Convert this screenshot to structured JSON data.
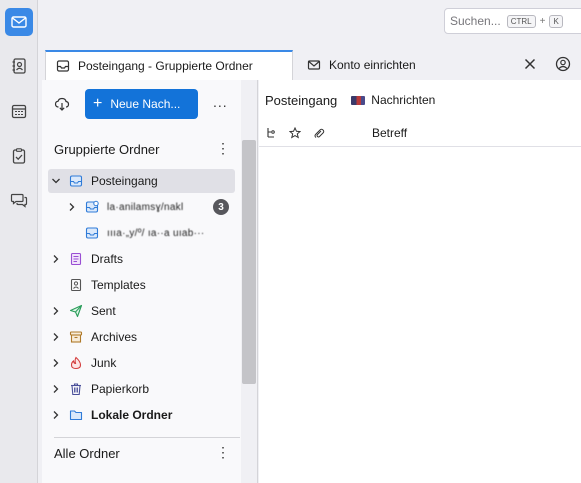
{
  "spaces": [
    {
      "name": "mail",
      "active": true
    },
    {
      "name": "address-book",
      "active": false
    },
    {
      "name": "calendar",
      "active": false
    },
    {
      "name": "tasks",
      "active": false
    },
    {
      "name": "chat",
      "active": false
    }
  ],
  "search": {
    "placeholder": "Suchen...",
    "shortcut_mod": "CTRL",
    "shortcut_plus": "+",
    "shortcut_key": "K"
  },
  "tabs": [
    {
      "label": "Posteingang - Gruppierte Ordner",
      "active": true
    },
    {
      "label": "Konto einrichten",
      "active": false
    }
  ],
  "folder_pane": {
    "new_message_label": "Neue Nach...",
    "more_label": "...",
    "section_grouped": "Gruppierte Ordner",
    "section_all": "Alle Ordner",
    "menu_glyph": "⋮",
    "folders": [
      {
        "label": "Posteingang",
        "icon": "inbox-icon",
        "selected": true,
        "twisty": "open"
      },
      {
        "label": "la·anilamsɣ/nakl",
        "icon": "inbox-sync-icon",
        "twisty": "closed",
        "badge": "3",
        "blurred": true
      },
      {
        "label": "ıııa·„y/º/ ıa··a uıab···",
        "icon": "inbox-icon",
        "twisty": "none",
        "blurred": true
      },
      {
        "label": "Drafts",
        "icon": "drafts-icon",
        "twisty": "closed"
      },
      {
        "label": "Templates",
        "icon": "templates-icon",
        "twisty": "none"
      },
      {
        "label": "Sent",
        "icon": "sent-icon",
        "twisty": "closed"
      },
      {
        "label": "Archives",
        "icon": "archive-icon",
        "twisty": "closed"
      },
      {
        "label": "Junk",
        "icon": "junk-icon",
        "twisty": "closed"
      },
      {
        "label": "Papierkorb",
        "icon": "trash-icon",
        "twisty": "closed"
      },
      {
        "label": "Lokale Ordner",
        "icon": "folder-icon",
        "twisty": "closed",
        "bold": true
      }
    ]
  },
  "message_pane": {
    "title": "Posteingang",
    "account": "Nachrichten",
    "column_subject": "Betreff"
  },
  "colors": {
    "accent": "#3a89e6",
    "new_button": "#1373d9"
  }
}
